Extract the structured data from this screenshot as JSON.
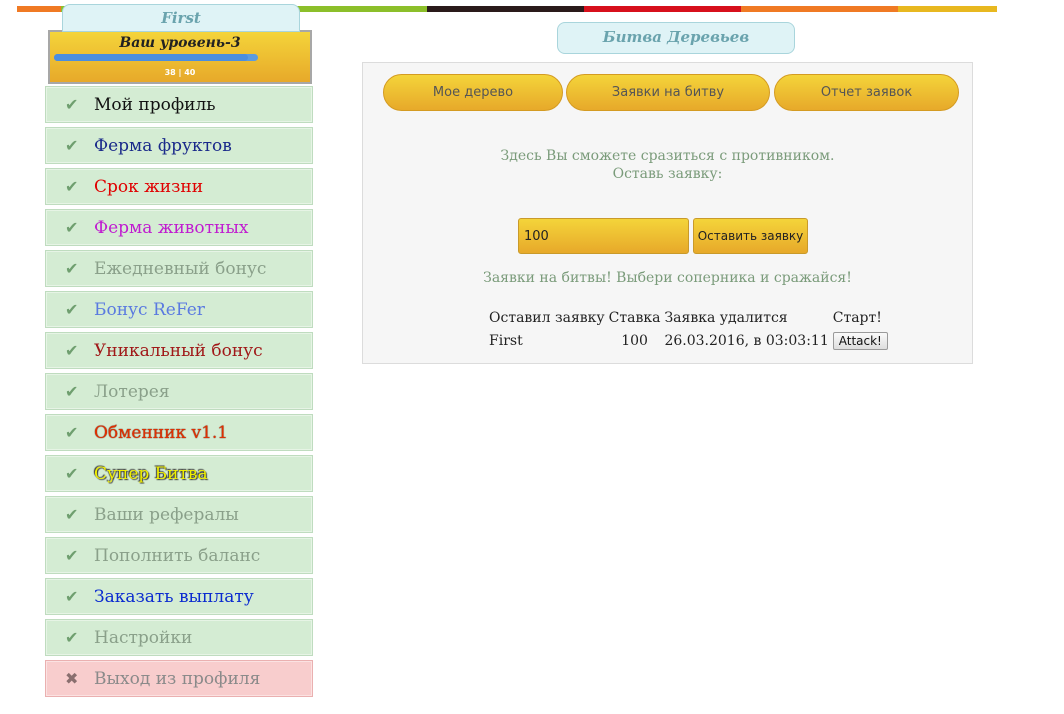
{
  "header": {
    "stripe_colors": [
      "#f07a24",
      "#8cbf2a",
      "#2a1a1a",
      "#d7101c",
      "#f07a24",
      "#e8b820"
    ],
    "username": "First",
    "level_label": "Ваш уровень-3",
    "level_count": "38 | 40",
    "level_progress": 0.95
  },
  "sidebar": {
    "items": [
      {
        "label": "Мой профиль",
        "icon": "check-icon",
        "color": "#111111"
      },
      {
        "label": "Ферма фруктов",
        "icon": "check-icon",
        "color": "#1a2a8a"
      },
      {
        "label": "Срок жизни",
        "icon": "check-icon",
        "color": "#e00000"
      },
      {
        "label": "Ферма животных",
        "icon": "check-icon",
        "color": "#c01cd0"
      },
      {
        "label": "Ежедневный бонус",
        "icon": "check-icon",
        "color": "#8aa08a"
      },
      {
        "label": "Бонус ReFer",
        "icon": "check-icon",
        "color": "#5a7ae0"
      },
      {
        "label": "Уникальный бонус",
        "icon": "check-icon",
        "color": "#a01818"
      },
      {
        "label": "Лотерея",
        "icon": "check-icon",
        "color": "#8aa08a"
      },
      {
        "label": "Обменник v1.1",
        "icon": "check-icon",
        "color": "#e03000"
      },
      {
        "label": "Супер Битва",
        "icon": "check-icon",
        "color": "#f0f000"
      },
      {
        "label": "Ваши рефералы",
        "icon": "check-icon",
        "color": "#8aa08a"
      },
      {
        "label": "Пополнить баланс",
        "icon": "check-icon",
        "color": "#8aa08a"
      },
      {
        "label": "Заказать выплату",
        "icon": "check-icon",
        "color": "#0a2ad0"
      },
      {
        "label": "Настройки",
        "icon": "check-icon",
        "color": "#8aa08a"
      },
      {
        "label": "Выход из профиля",
        "icon": "close-icon",
        "color": "#8a8a8a"
      }
    ]
  },
  "page": {
    "title": "Битва Деревьев",
    "tabs": [
      "Мое дерево",
      "Заявки на битву",
      "Отчет заявок"
    ],
    "info_line1": "Здесь Вы сможете сразиться с противником.",
    "info_line2": "Оставь заявку:",
    "bid_value": "100",
    "bid_button": "Оставить заявку",
    "battles_note": "Заявки на битвы! Выбери соперника и сражайся!",
    "table": {
      "headers": [
        "Оставил заявку",
        "Ставка",
        "Заявка удалится",
        "Старт!"
      ],
      "rows": [
        {
          "author": "First",
          "bet": "100",
          "expires": "26.03.2016, в 03:03:11",
          "action": "Attack!"
        }
      ]
    }
  }
}
